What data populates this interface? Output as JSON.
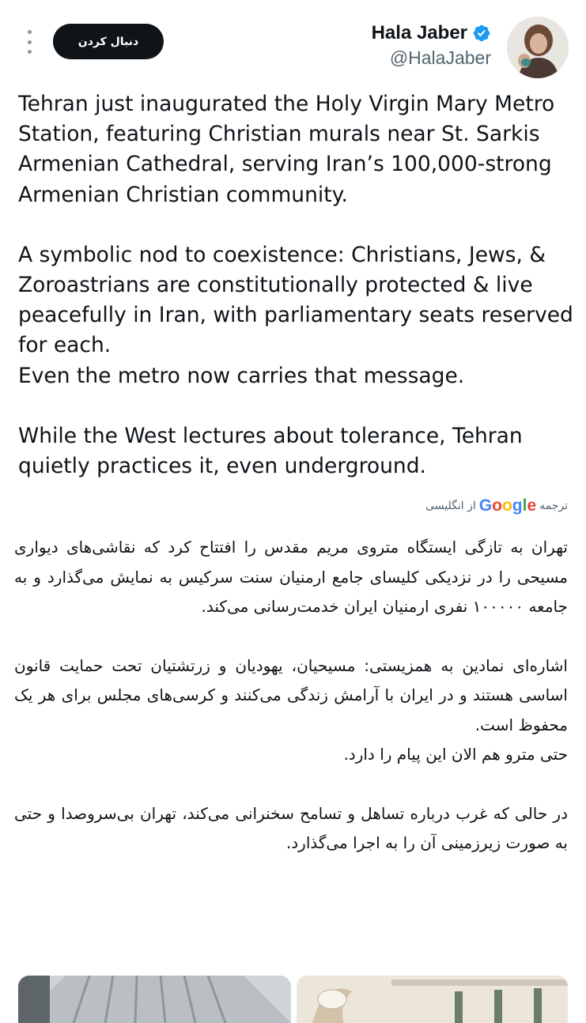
{
  "header": {
    "more_icon": "more-vertical-icon",
    "follow_label": "دنبال کردن",
    "display_name": "Hala Jaber",
    "verified_icon": "verified-badge-icon",
    "verified_color": "#1d9bf0",
    "handle": "@HalaJaber"
  },
  "tweet": {
    "paragraphs_en": [
      "Tehran just inaugurated the Holy Virgin Mary Metro Station, featuring Christian murals near St. Sarkis Armenian Cathedral, serving Iran’s 100,000-strong Armenian Christian community.",
      "A symbolic nod to coexistence: Christians, Jews, & Zoroastrians are constitutionally protected & live peacefully in Iran, with parliamentary seats reserved for each.",
      "Even the metro now carries that message.",
      "While the West lectures about tolerance, Tehran quietly practices it, even underground."
    ]
  },
  "translation": {
    "prefix": "ترجمه",
    "provider_letters": [
      "G",
      "o",
      "o",
      "g",
      "l",
      "e"
    ],
    "suffix": "از انگلیسی",
    "paragraphs_fa": [
      "تهران به تازگی ایستگاه متروی مریم مقدس را افتتاح کرد که نقاشی‌های دیواری مسیحی را در نزدیکی کلیسای جامع ارمنیان سنت سرکیس به نمایش می‌گذارد و به جامعه ۱۰۰۰۰۰ نفری ارمنیان ایران خدمت‌رسانی می‌کند.",
      "اشاره‌ای نمادین به همزیستی: مسیحیان، یهودیان و زرتشتیان تحت حمایت قانون اساسی هستند و در ایران با آرامش زندگی می‌کنند و کرسی‌های مجلس برای هر یک محفوظ است.",
      "حتی مترو هم الان این پیام را دارد.",
      "در حالی که غرب درباره تساهل و تسامح سخنرانی می‌کند، تهران بی‌سروصدا و حتی به صورت زیرزمینی آن را به اجرا می‌گذارد."
    ]
  },
  "media": {
    "images": [
      "metro-station-photo",
      "metro-mural-photo"
    ]
  },
  "colors": {
    "text_primary": "#0f1419",
    "text_secondary": "#536471",
    "button_bg": "#0f1419"
  }
}
